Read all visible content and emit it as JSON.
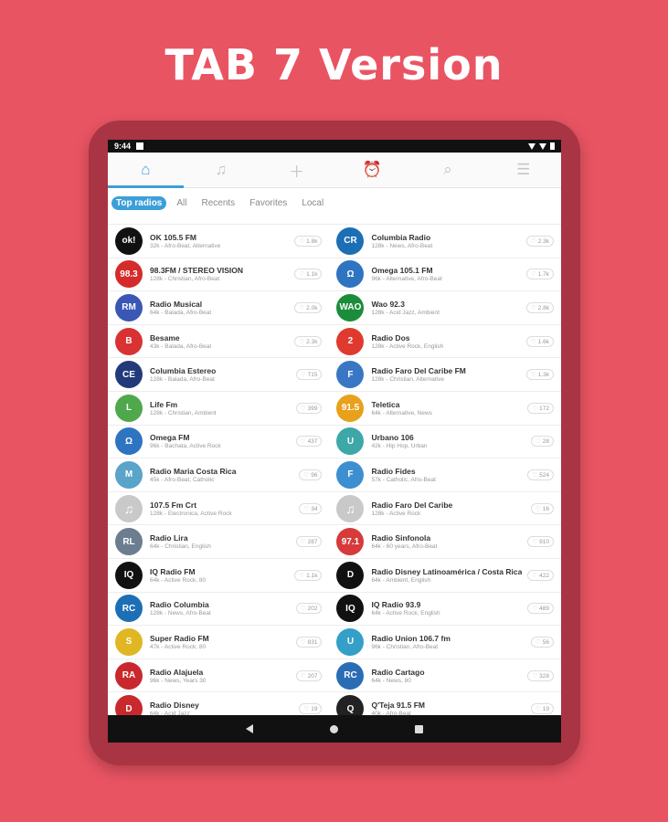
{
  "headline": "TAB 7 Version",
  "status": {
    "time": "9:44"
  },
  "toolbar": {
    "icons": [
      "home-icon",
      "music-icon",
      "plus-icon",
      "alarm-icon",
      "search-icon",
      "menu-icon"
    ]
  },
  "filters": [
    "Top radios",
    "All",
    "Recents",
    "Favorites",
    "Local"
  ],
  "stations": [
    {
      "name": "OK 105.5 FM",
      "sub": "32k - Afro-Beat, Alternative",
      "likes": "1.8k",
      "color": "#111",
      "mark": "ok!"
    },
    {
      "name": "Columbia Radio",
      "sub": "128k - News, Afro-Beat",
      "likes": "2.3k",
      "color": "#1c6fb5",
      "mark": "CR"
    },
    {
      "name": "98.3FM / STEREO VISION",
      "sub": "128k - Christian, Afro-Beat",
      "likes": "1.1k",
      "color": "#d62b2b",
      "mark": "98.3"
    },
    {
      "name": "Omega 105.1 FM",
      "sub": "96k - Alternative, Afro-Beat",
      "likes": "1.7k",
      "color": "#2f74c0",
      "mark": "Ω"
    },
    {
      "name": "Radio Musical",
      "sub": "64k - Balada, Afro-Beat",
      "likes": "2.0k",
      "color": "#3a57b5",
      "mark": "RM"
    },
    {
      "name": "Wao 92.3",
      "sub": "128k - Acid Jazz, Ambient",
      "likes": "2.8k",
      "color": "#1b8d3a",
      "mark": "WAO"
    },
    {
      "name": "Besame",
      "sub": "43k - Balada, Afro-Beat",
      "likes": "2.3k",
      "color": "#d93232",
      "mark": "B"
    },
    {
      "name": "Radio Dos",
      "sub": "128k - Active Rock, English",
      "likes": "1.6k",
      "color": "#e03a2f",
      "mark": "2"
    },
    {
      "name": "Columbia Estereo",
      "sub": "128k - Balada, Afro-Beat",
      "likes": "715",
      "color": "#233a7a",
      "mark": "CE"
    },
    {
      "name": "Radio Faro Del Caribe FM",
      "sub": "128k - Christian, Alternative",
      "likes": "1.3k",
      "color": "#3977c5",
      "mark": "F"
    },
    {
      "name": "Life Fm",
      "sub": "128k - Christian, Ambient",
      "likes": "399",
      "color": "#4fa84c",
      "mark": "L"
    },
    {
      "name": "Teletica",
      "sub": "64k - Alternative, News",
      "likes": "172",
      "color": "#e8a11a",
      "mark": "91.5"
    },
    {
      "name": "Omega FM",
      "sub": "96k - Bachata, Active Rock",
      "likes": "437",
      "color": "#2f74c0",
      "mark": "Ω"
    },
    {
      "name": "Urbano 106",
      "sub": "42k - Hip Hop, Urban",
      "likes": "28",
      "color": "#3ea7a8",
      "mark": "U"
    },
    {
      "name": "Radio Maria Costa Rica",
      "sub": "45k - Afro-Beat, Catholic",
      "likes": "96",
      "color": "#5aa3c9",
      "mark": "M"
    },
    {
      "name": "Radio Fides",
      "sub": "57k - Catholic, Afro-Beat",
      "likes": "524",
      "color": "#3c8fd0",
      "mark": "F"
    },
    {
      "name": "107.5 Fm Crt",
      "sub": "128k - Electronica, Active Rock",
      "likes": "34",
      "color": "#c9c9c9",
      "mark": "♫"
    },
    {
      "name": "Radio Faro Del Caribe",
      "sub": "128k - Active Rock",
      "likes": "16",
      "color": "#c9c9c9",
      "mark": "♫"
    },
    {
      "name": "Radio Lira",
      "sub": "64k - Christian, English",
      "likes": "287",
      "color": "#6b7d8f",
      "mark": "RL"
    },
    {
      "name": "Radio Sinfonola",
      "sub": "64k - 60 years, Afro-Beat",
      "likes": "910",
      "color": "#d63a3a",
      "mark": "97.1"
    },
    {
      "name": "IQ Radio FM",
      "sub": "64k - Active Rock, 80",
      "likes": "1.1k",
      "color": "#111",
      "mark": "IQ"
    },
    {
      "name": "Radio Disney Latinoamérica / Costa Rica",
      "sub": "64k - Ambient, English",
      "likes": "422",
      "color": "#111",
      "mark": "D"
    },
    {
      "name": "Radio Columbia",
      "sub": "128k - News, Afro-Beat",
      "likes": "202",
      "color": "#1c6fb5",
      "mark": "RC"
    },
    {
      "name": "IQ Radio 93.9",
      "sub": "64k - Active Rock, English",
      "likes": "489",
      "color": "#111",
      "mark": "IQ"
    },
    {
      "name": "Super Radio FM",
      "sub": "47k - Active Rock, 80",
      "likes": "831",
      "color": "#e0b622",
      "mark": "S"
    },
    {
      "name": "Radio Union 106.7 fm",
      "sub": "96k - Christian, Afro-Beat",
      "likes": "56",
      "color": "#34a0c7",
      "mark": "U"
    },
    {
      "name": "Radio Alajuela",
      "sub": "96k - News, Years 30",
      "likes": "207",
      "color": "#c9282d",
      "mark": "RA"
    },
    {
      "name": "Radio Cartago",
      "sub": "64k - News, 80",
      "likes": "328",
      "color": "#2b6db5",
      "mark": "RC"
    },
    {
      "name": "Radio Disney",
      "sub": "64k - Acid Jazz",
      "likes": "19",
      "color": "#c9282d",
      "mark": "D"
    },
    {
      "name": "Q'Teja 91.5 FM",
      "sub": "40k - Afro-Beat",
      "likes": "19",
      "color": "#222",
      "mark": "Q"
    }
  ]
}
